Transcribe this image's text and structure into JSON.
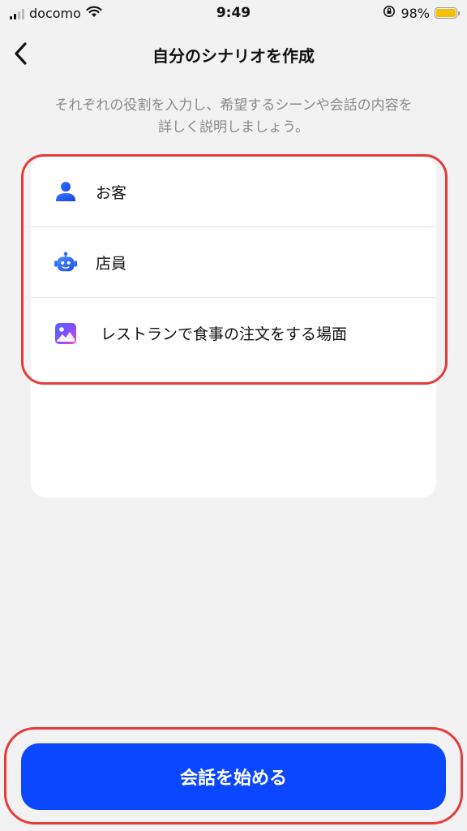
{
  "status_bar": {
    "carrier": "docomo",
    "time": "9:49",
    "battery_percent": "98%",
    "battery_level": 0.98,
    "battery_color": "#f5c000"
  },
  "header": {
    "back_icon": "chevron-left-icon",
    "title": "自分のシナリオを作成"
  },
  "subtitle": "それぞれの役割を入力し、希望するシーンや会話の内容を詳しく説明しましょう。",
  "scenario": {
    "items": [
      {
        "icon": "person-icon",
        "label": "お客"
      },
      {
        "icon": "robot-icon",
        "label": "店員"
      },
      {
        "icon": "image-icon",
        "label": "レストランで食事の注文をする場面"
      }
    ]
  },
  "cta": {
    "label": "会話を始める",
    "color": "#0a47ff"
  },
  "highlight_color": "#e53b3b"
}
